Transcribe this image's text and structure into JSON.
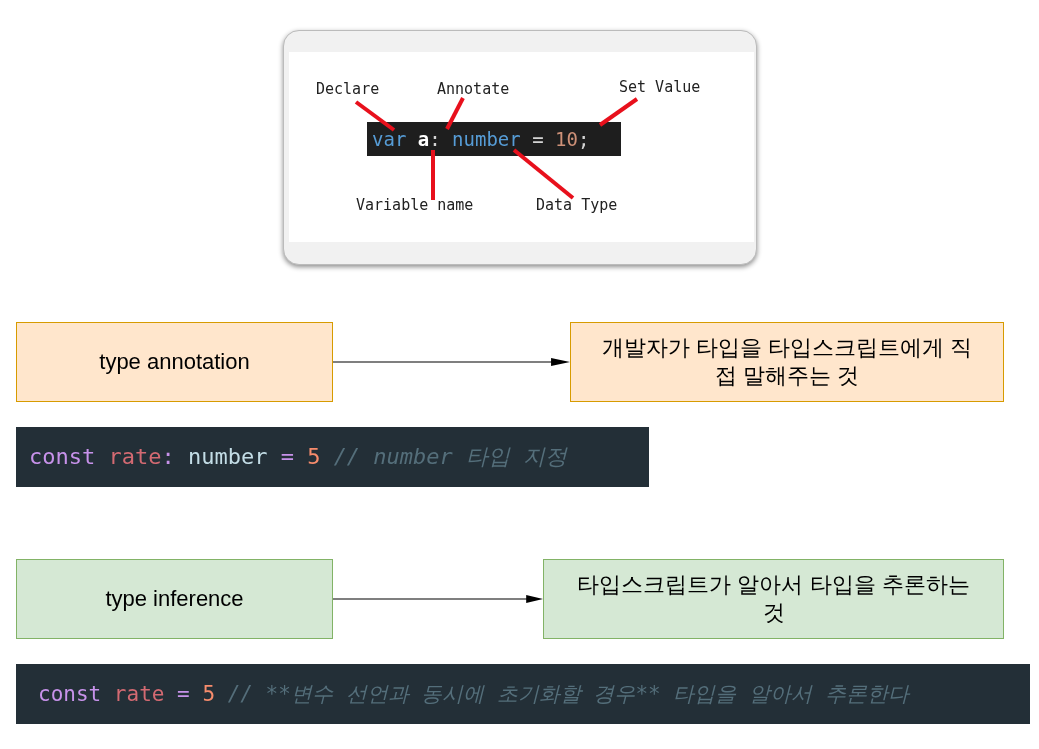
{
  "annotation_figure": {
    "labels": [
      "Declare",
      "Annotate",
      "Set Value",
      "Variable name",
      "Data Type"
    ],
    "code": [
      {
        "kind": "keyword",
        "text": "var"
      },
      {
        "kind": "variable",
        "text": "a"
      },
      {
        "kind": "punct",
        "text": ":"
      },
      {
        "kind": "type",
        "text": "number"
      },
      {
        "kind": "operator",
        "text": "="
      },
      {
        "kind": "number",
        "text": "10"
      },
      {
        "kind": "punct",
        "text": ";"
      }
    ]
  },
  "rows": [
    {
      "kind": "annotation",
      "term": "type annotation",
      "description": "개발자가 타입을 타입스크립트에게 직접 말해주는 것",
      "code": [
        {
          "kind": "keyword",
          "text": "const"
        },
        {
          "kind": "variable",
          "text": "rate"
        },
        {
          "kind": "punct",
          "text": ":"
        },
        {
          "kind": "type",
          "text": "number"
        },
        {
          "kind": "operator",
          "text": "="
        },
        {
          "kind": "number",
          "text": "5"
        },
        {
          "kind": "comment",
          "text": "// number 타입 지정"
        }
      ]
    },
    {
      "kind": "inference",
      "term": "type inference",
      "description": "타입스크립트가 알아서 타입을 추론하는 것",
      "code": [
        {
          "kind": "keyword",
          "text": "const"
        },
        {
          "kind": "variable",
          "text": "rate"
        },
        {
          "kind": "operator",
          "text": "="
        },
        {
          "kind": "number",
          "text": "5"
        },
        {
          "kind": "comment",
          "text": "// **변수 선언과 동시에 초기화할 경우** 타입을 알아서 추론한다"
        }
      ]
    }
  ]
}
